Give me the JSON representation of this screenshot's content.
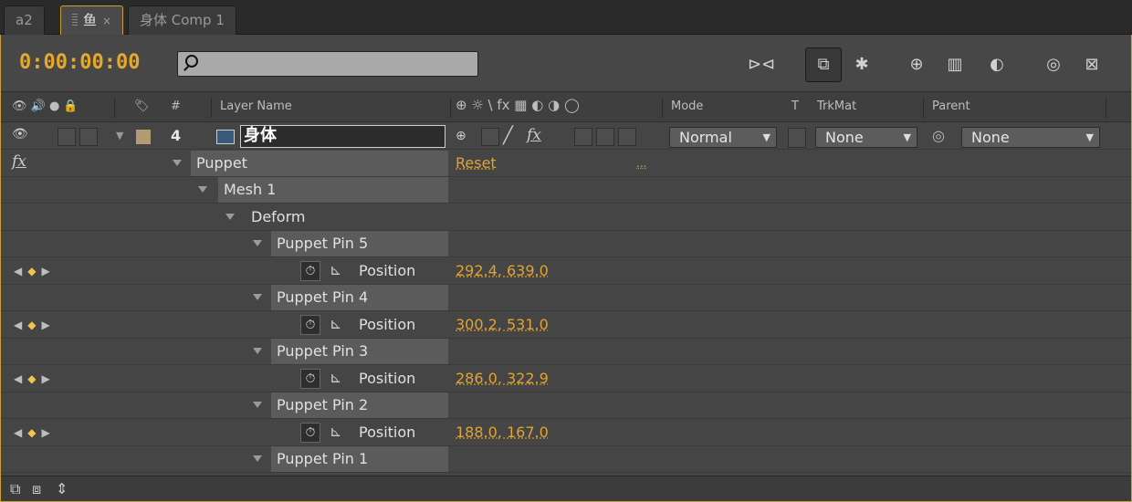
{
  "tabs": [
    {
      "label": "a2"
    },
    {
      "label": "鱼",
      "active": true
    },
    {
      "label": "身体 Comp 1"
    }
  ],
  "toolbar": {
    "timecode": "0:00:00:00",
    "search_placeholder": "",
    "icons": [
      "comp-flowchart-icon",
      "draft-3d-icon",
      "shy-layers-icon",
      "frame-blending-icon",
      "motion-blur-icon",
      "graph-editor-icon",
      "brainstorm-icon",
      "live-update-icon"
    ]
  },
  "header": {
    "switches_icons": "👁 🔊 ● 🔒",
    "label_icon": "🏷",
    "hash": "#",
    "layer_name": "Layer Name",
    "switch_row": "⊕ ☼ \\ fx ▦ ◐ ◑ ◯",
    "mode": "Mode",
    "t": "T",
    "trkmat": "TrkMat",
    "parent": "Parent"
  },
  "layer": {
    "number": "4",
    "name": "身体",
    "mode": "Normal",
    "trkmat": "None",
    "parent": "None",
    "fx_label": "fx"
  },
  "tree": {
    "fx": "fx",
    "puppet": "Puppet",
    "reset": "Reset",
    "ellipsis": "...",
    "mesh": "Mesh 1",
    "deform": "Deform",
    "position_label": "Position",
    "pins": [
      {
        "name": "Puppet Pin 5",
        "position": "292.4, 639.0"
      },
      {
        "name": "Puppet Pin 4",
        "position": "300.2, 531.0"
      },
      {
        "name": "Puppet Pin 3",
        "position": "286.0, 322.9"
      },
      {
        "name": "Puppet Pin 2",
        "position": "188.0, 167.0"
      },
      {
        "name": "Puppet Pin 1"
      }
    ]
  },
  "colors": {
    "accent": "#e8a82a",
    "panel_border": "#c8a03a",
    "panel_bg": "#454545"
  }
}
